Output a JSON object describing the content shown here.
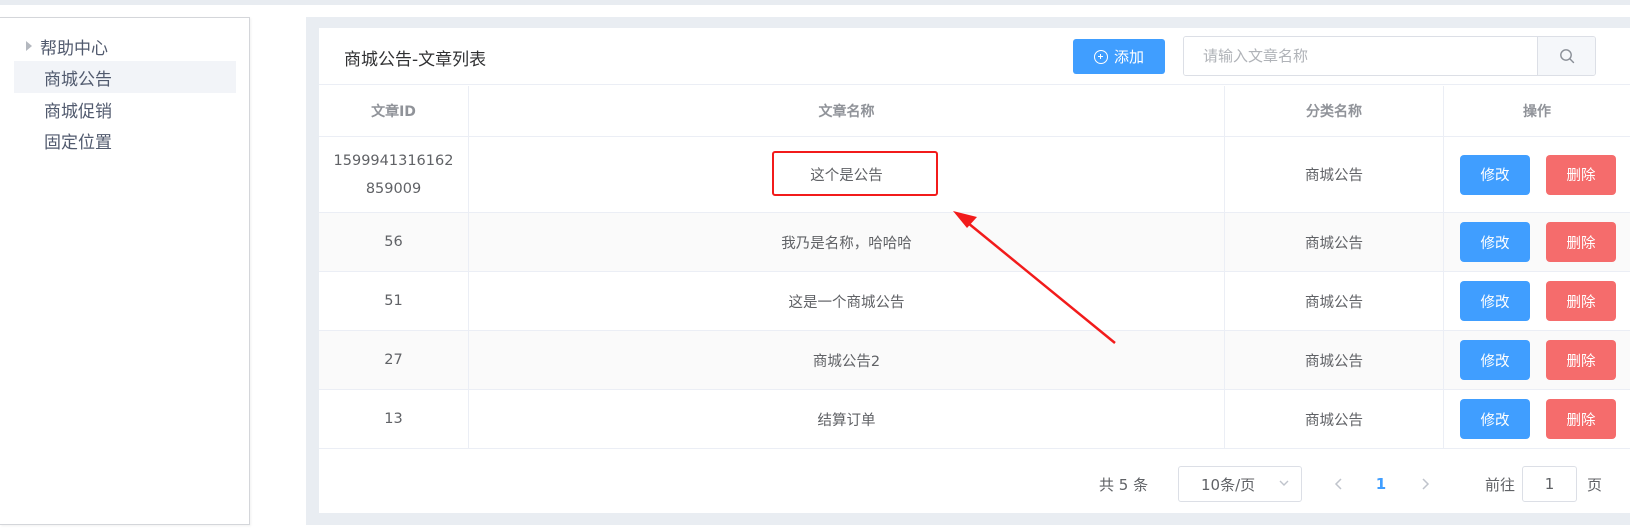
{
  "sidebar": {
    "items": [
      {
        "label": "帮助中心",
        "type": "parent"
      },
      {
        "label": "商城公告",
        "type": "leaf",
        "active": true
      },
      {
        "label": "商城促销",
        "type": "leaf"
      },
      {
        "label": "固定位置",
        "type": "leaf"
      }
    ]
  },
  "header": {
    "title": "商城公告-文章列表",
    "add_label": "添加",
    "search_placeholder": "请输入文章名称"
  },
  "table": {
    "columns": [
      "文章ID",
      "文章名称",
      "分类名称",
      "操作"
    ],
    "rows": [
      {
        "id": "1599941316162859009",
        "name": "这个是公告",
        "category": "商城公告"
      },
      {
        "id": "56",
        "name": "我乃是名称，哈哈哈",
        "category": "商城公告"
      },
      {
        "id": "51",
        "name": "这是一个商城公告",
        "category": "商城公告"
      },
      {
        "id": "27",
        "name": "商城公告2",
        "category": "商城公告"
      },
      {
        "id": "13",
        "name": "结算订单",
        "category": "商城公告"
      }
    ],
    "edit_label": "修改",
    "delete_label": "删除"
  },
  "pagination": {
    "total_text": "共 5 条",
    "page_size": "10条/页",
    "current_page": "1",
    "goto_label": "前往",
    "goto_value": "1",
    "goto_suffix": "页"
  },
  "colors": {
    "primary": "#409eff",
    "danger": "#f56c6c",
    "annotation": "#f21b1b"
  }
}
